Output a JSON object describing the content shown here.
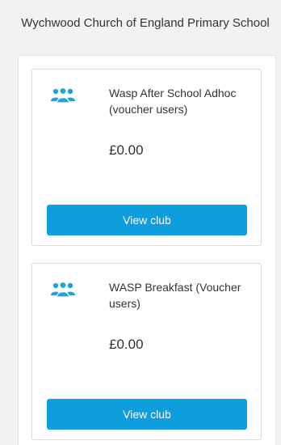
{
  "school": {
    "title": "Wychwood Church of England Primary School"
  },
  "clubs": [
    {
      "icon": "group-users-icon",
      "name": "Wasp After School Adhoc (voucher users)",
      "price": "£0.00",
      "button_label": "View club"
    },
    {
      "icon": "group-users-icon",
      "name": "WASP Breakfast (Voucher users)",
      "price": "£0.00",
      "button_label": "View club"
    }
  ],
  "colors": {
    "accent": "#0e9ddd",
    "icon": "#1fa3d9",
    "background": "#f2f2f2",
    "card": "#ffffff"
  }
}
